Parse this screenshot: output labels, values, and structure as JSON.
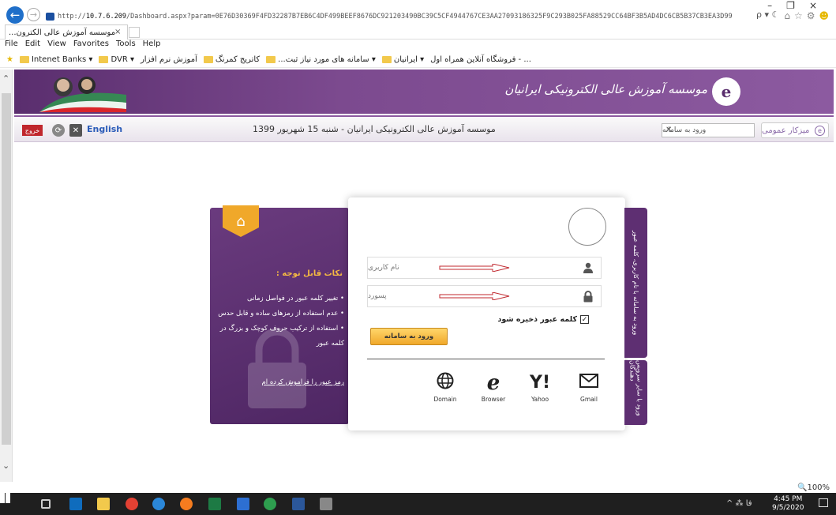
{
  "browser": {
    "url_prefix": "http://",
    "url_host": "10.7.6.209",
    "url_rest": "/Dashboard.aspx?param=0E76D30369F4FD32287B7EB6C4DF499BEEF8676DC921203490BC39C5CF4944767CE3AA27093186325F9C293B025FA88529CC64BF3B5AD4DC6CB5B37CB3EA3D99",
    "addr_tools": "ρ ▾ ☾",
    "tab_title": "موسسه آموزش عالی الکترون...",
    "tab_close": "×",
    "menu": [
      "File",
      "Edit",
      "View",
      "Favorites",
      "Tools",
      "Help"
    ],
    "favorites": [
      "Intenet Banks ▾",
      "DVR ▾",
      "آموزش نرم افزار",
      "کاتریج کمرنگ",
      "...سامانه های مورد نیاز ثبت ▾",
      "ایرانیان ▾",
      "فروشگاه آنلاین همراه اول - ..."
    ],
    "zoom": "🔍100% ▾"
  },
  "header": {
    "logo_text": "موسسه آموزش عالی الکترونیکی ایرانیان",
    "logo_mark": "e"
  },
  "infobar": {
    "logout": "خروج",
    "english": "English",
    "date": "1399 شهریور 15 شنبه",
    "title": "موسسه آموزش عالی الکترونیکی ایرانیان - شنبه 15 شهریور 1399",
    "search_placeholder": "ورود به سامانه",
    "search_clear": "✕",
    "services": "میزکار عمومی"
  },
  "notes": {
    "title": "نکات قابل توجه :",
    "items": [
      "تغییر کلمه عبور در فواصل زمانی",
      "عدم استفاده از رمزهای ساده و قابل حدس",
      "استفاده از ترکیب حروف کوچک و بزرگ در کلمه عبور"
    ],
    "forgot": "رمز عبور را فراموش کرده ام"
  },
  "login": {
    "username_placeholder": "نام کاربری",
    "password_placeholder": "پسورد",
    "remember": "کلمه عبور ذخیره شود",
    "submit": "ورود به سامانه"
  },
  "services": [
    {
      "label": "Domain",
      "glyph": "🌐"
    },
    {
      "label": "Browser",
      "glyph": "e"
    },
    {
      "label": "Yahoo",
      "glyph": "Y!"
    },
    {
      "label": "Gmail",
      "glyph": "✉"
    }
  ],
  "side_tabs": {
    "login_user": "ورود به سامانه با نام کاربری، کلمه عبور",
    "other_services": "ورود با سایر سرویس دهندگان"
  },
  "taskbar": {
    "tray": "^ ⁂ فا",
    "time": "4:45 PM",
    "date": "9/5/2020"
  },
  "colors": {
    "brand_purple": "#5e2f72",
    "accent_orange": "#f0a82a",
    "arrow_red": "#c0272d"
  }
}
